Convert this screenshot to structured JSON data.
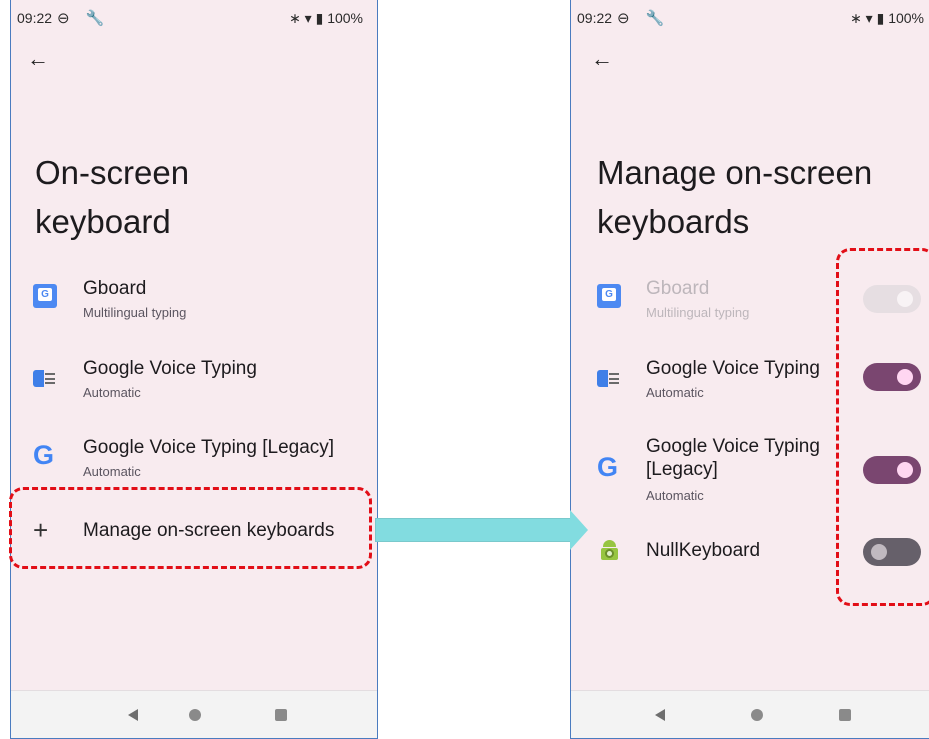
{
  "status_bar": {
    "time": "09:22",
    "icons_left": "⊖ 🔧",
    "icons_right": "∗ ▾ ▮ 100%"
  },
  "left_screen": {
    "title_line1": "On-screen",
    "title_line2": "keyboard",
    "items": [
      {
        "label": "Gboard",
        "sub": "Multilingual typing",
        "icon": "gboard-icon"
      },
      {
        "label": "Google Voice Typing",
        "sub": "Automatic",
        "icon": "google-voice-typing-icon"
      },
      {
        "label": "Google Voice Typing [Legacy]",
        "sub": "Automatic",
        "icon": "google-g-icon"
      },
      {
        "label": "Manage on-screen keyboards",
        "icon": "plus-icon"
      }
    ]
  },
  "right_screen": {
    "title_line1": "Manage on-screen",
    "title_line2": "keyboards",
    "items": [
      {
        "label": "Gboard",
        "sub": "Multilingual typing",
        "icon": "gboard-icon",
        "toggle": "on-disabled"
      },
      {
        "label": "Google Voice Typing",
        "sub": "Automatic",
        "icon": "google-voice-typing-icon",
        "toggle": "on"
      },
      {
        "label_line1": "Google Voice Typing",
        "label_line2": "[Legacy]",
        "sub": "Automatic",
        "icon": "google-g-icon",
        "toggle": "on"
      },
      {
        "label": "NullKeyboard",
        "icon": "android-keyboard-icon",
        "toggle": "off"
      }
    ]
  },
  "glyphs": {
    "back_arrow": "←",
    "g": "G",
    "gboard_g": "G",
    "plus": "+"
  },
  "colors": {
    "highlight": "#e20e17",
    "arrow": "#82dce0",
    "toggle_on": "#7a4670",
    "toggle_off": "#66606a",
    "screen_bg": "#f8ebef"
  }
}
